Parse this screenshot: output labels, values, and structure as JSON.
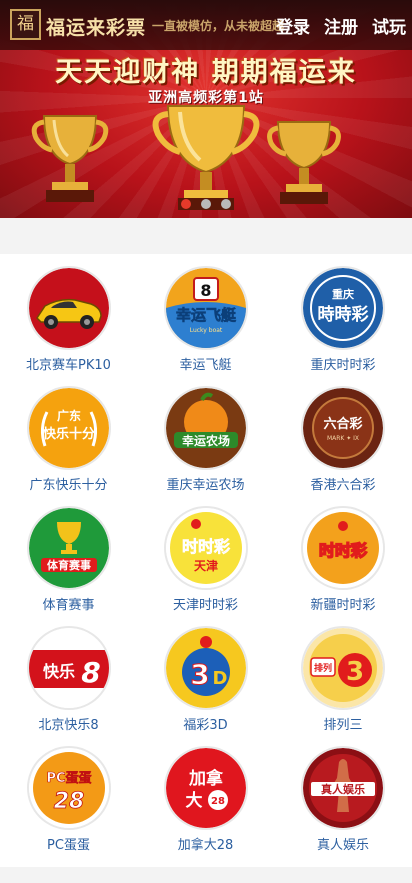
{
  "header": {
    "logo_mark": "福",
    "logo_text": "福运来彩票",
    "slogan": "一直被模仿，从未被超越",
    "login": "登录",
    "register": "注册",
    "trial": "试玩"
  },
  "banner": {
    "headline": "天天迎财神 期期福运来",
    "subhead": "亚洲高频彩第1站",
    "slides": 3,
    "active_slide": 1
  },
  "games": [
    {
      "label": "北京赛车PK10",
      "icon": "race-car-icon"
    },
    {
      "label": "幸运飞艇",
      "icon": "lucky-boat-icon"
    },
    {
      "label": "重庆时时彩",
      "icon": "chongqing-ssc-icon"
    },
    {
      "label": "广东快乐十分",
      "icon": "guangdong-happy-ten-icon"
    },
    {
      "label": "重庆幸运农场",
      "icon": "lucky-farm-icon"
    },
    {
      "label": "香港六合彩",
      "icon": "mark-six-icon"
    },
    {
      "label": "体育赛事",
      "icon": "sports-trophy-icon"
    },
    {
      "label": "天津时时彩",
      "icon": "tianjin-ssc-icon"
    },
    {
      "label": "新疆时时彩",
      "icon": "xinjiang-ssc-icon"
    },
    {
      "label": "北京快乐8",
      "icon": "beijing-happy-8-icon"
    },
    {
      "label": "福彩3D",
      "icon": "welfare-3d-icon"
    },
    {
      "label": "排列三",
      "icon": "pailie-3-icon"
    },
    {
      "label": "PC蛋蛋",
      "icon": "pc-egg-icon"
    },
    {
      "label": "加拿大28",
      "icon": "canada-28-icon"
    },
    {
      "label": "真人娱乐",
      "icon": "live-casino-icon"
    }
  ],
  "icon_text": {
    "lucky_boat_number": "8",
    "lucky_boat_text": "幸运飞艇",
    "lucky_boat_sub": "Lucky boat",
    "cq_city": "重庆",
    "cq_name": "時時彩",
    "gd_top": "广东",
    "gd_bottom": "快乐十分",
    "farm": "幸运农场",
    "six_name": "六合彩",
    "six_sub": "MARK ✦ IX",
    "sports": "体育赛事",
    "tj_name": "时时彩",
    "tj_city": "天津",
    "xj_name": "时时彩",
    "h8_text": "快乐",
    "h8_num": "8",
    "w3d_num": "3",
    "w3d_d": "D",
    "pl_text": "排列",
    "pl_num": "3",
    "egg_top": "PC蛋蛋",
    "egg_num": "28",
    "ca_text1": "加拿",
    "ca_text2": "大",
    "ca_num": "28",
    "live_text": "真人娱乐"
  },
  "colors": {
    "banner_red": "#c8161d",
    "label_blue": "#2c5fa0",
    "gold": "#f2c14e",
    "active_dot": "#e63a2a"
  }
}
